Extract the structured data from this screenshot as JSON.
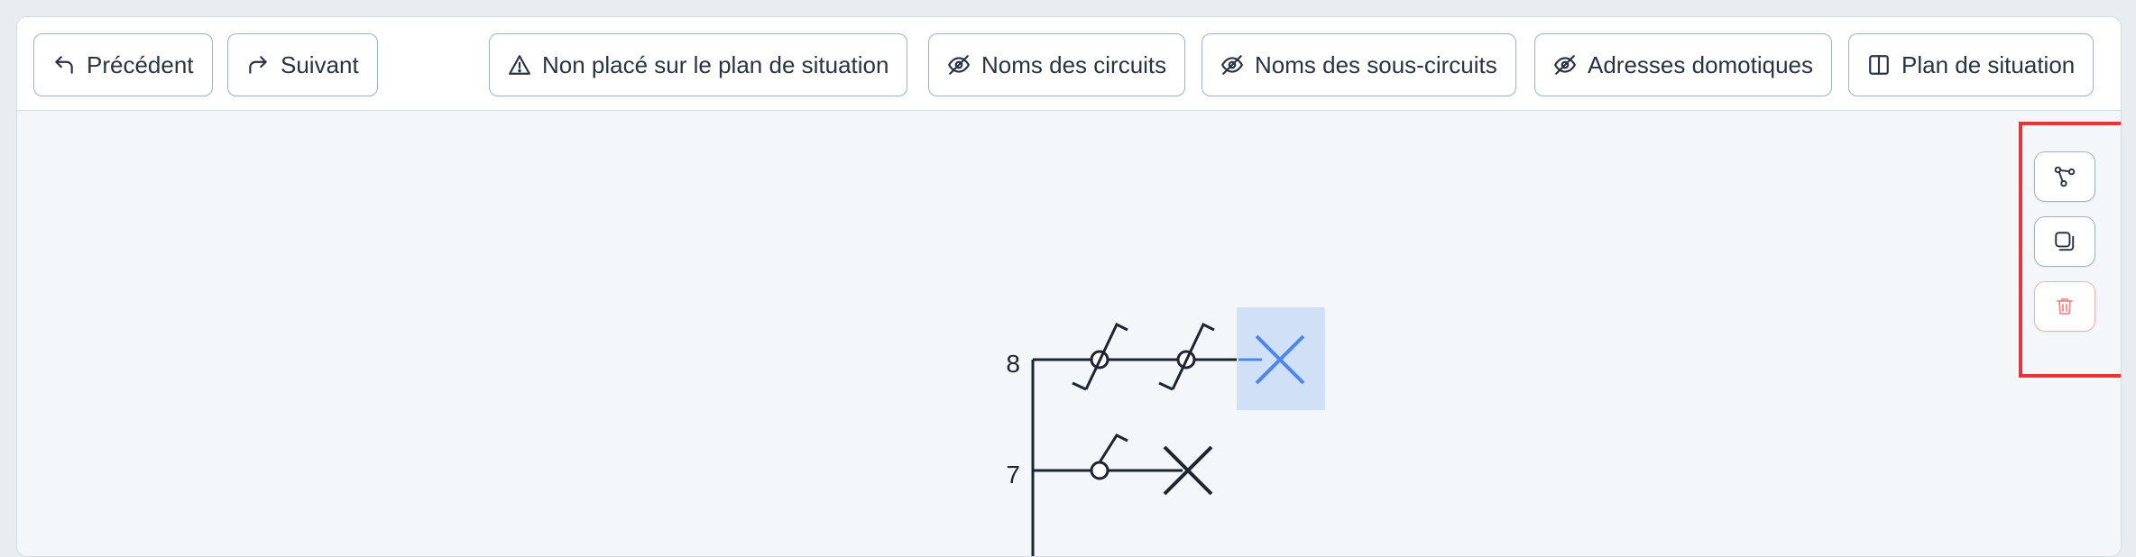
{
  "toolbar": {
    "previous_label": "Précédent",
    "next_label": "Suivant",
    "not_placed_label": "Non placé sur le plan de situation",
    "circuit_names_label": "Noms des circuits",
    "subcircuit_names_label": "Noms des sous-circuits",
    "home_automation_label": "Adresses domotiques",
    "site_plan_label": "Plan de situation"
  },
  "side_actions": {
    "icons": [
      "nodes-icon",
      "duplicate-icon",
      "trash-icon"
    ]
  },
  "diagram": {
    "circuits": [
      {
        "label": "8",
        "switches": 2,
        "selected_load": true
      },
      {
        "label": "7",
        "switches": 1,
        "selected_load": false
      }
    ]
  },
  "colors": {
    "accent": "#4f86e8",
    "selection_fill": "#cfe0f7",
    "danger": "#f28b8b",
    "highlight_frame": "#e0363c"
  }
}
